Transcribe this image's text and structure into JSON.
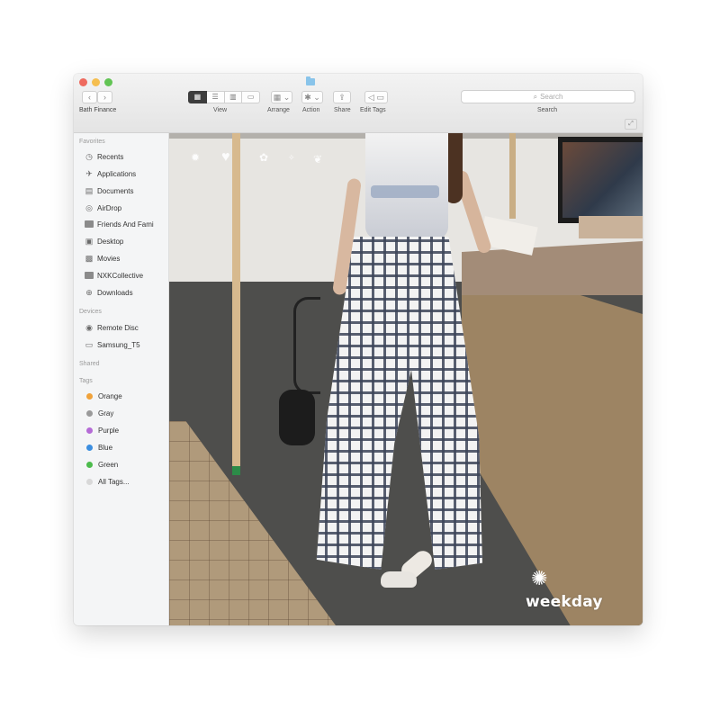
{
  "window": {
    "path_label": "Bath Finance",
    "traffic_lights": {
      "close": "#ee6a5e",
      "minimize": "#f5be4f",
      "zoom": "#62c454"
    }
  },
  "toolbar": {
    "back_icon": "chevron-left-icon",
    "forward_icon": "chevron-right-icon",
    "view_caption": "View",
    "arrange_caption": "Arrange",
    "action_caption": "Action",
    "share_caption": "Share",
    "edit_tags_caption": "Edit Tags",
    "search_placeholder": "Search",
    "search_caption": "Search"
  },
  "sidebar": {
    "favorites_header": "Favorites",
    "favorites": [
      {
        "label": "Recents",
        "icon": "clock-icon"
      },
      {
        "label": "Applications",
        "icon": "applications-icon"
      },
      {
        "label": "Documents",
        "icon": "documents-icon"
      },
      {
        "label": "AirDrop",
        "icon": "airdrop-icon"
      },
      {
        "label": "Friends And Fami",
        "icon": "folder-icon"
      },
      {
        "label": "Desktop",
        "icon": "desktop-icon"
      },
      {
        "label": "Movies",
        "icon": "movies-icon"
      },
      {
        "label": "NXKCollective",
        "icon": "folder-icon"
      },
      {
        "label": "Downloads",
        "icon": "downloads-icon"
      }
    ],
    "devices_header": "Devices",
    "devices": [
      {
        "label": "Remote Disc",
        "icon": "disc-icon"
      },
      {
        "label": "Samsung_T5",
        "icon": "drive-icon"
      }
    ],
    "shared_header": "Shared",
    "tags_header": "Tags",
    "tags": [
      {
        "label": "Orange",
        "color": "#f0a23a"
      },
      {
        "label": "Gray",
        "color": "#9a9a9a"
      },
      {
        "label": "Purple",
        "color": "#b56bd6"
      },
      {
        "label": "Blue",
        "color": "#3b8ee0"
      },
      {
        "label": "Green",
        "color": "#4cbb4c"
      },
      {
        "label": "All Tags...",
        "color": "#d8d8d8"
      }
    ]
  },
  "content": {
    "watermark_text": "weekday"
  }
}
